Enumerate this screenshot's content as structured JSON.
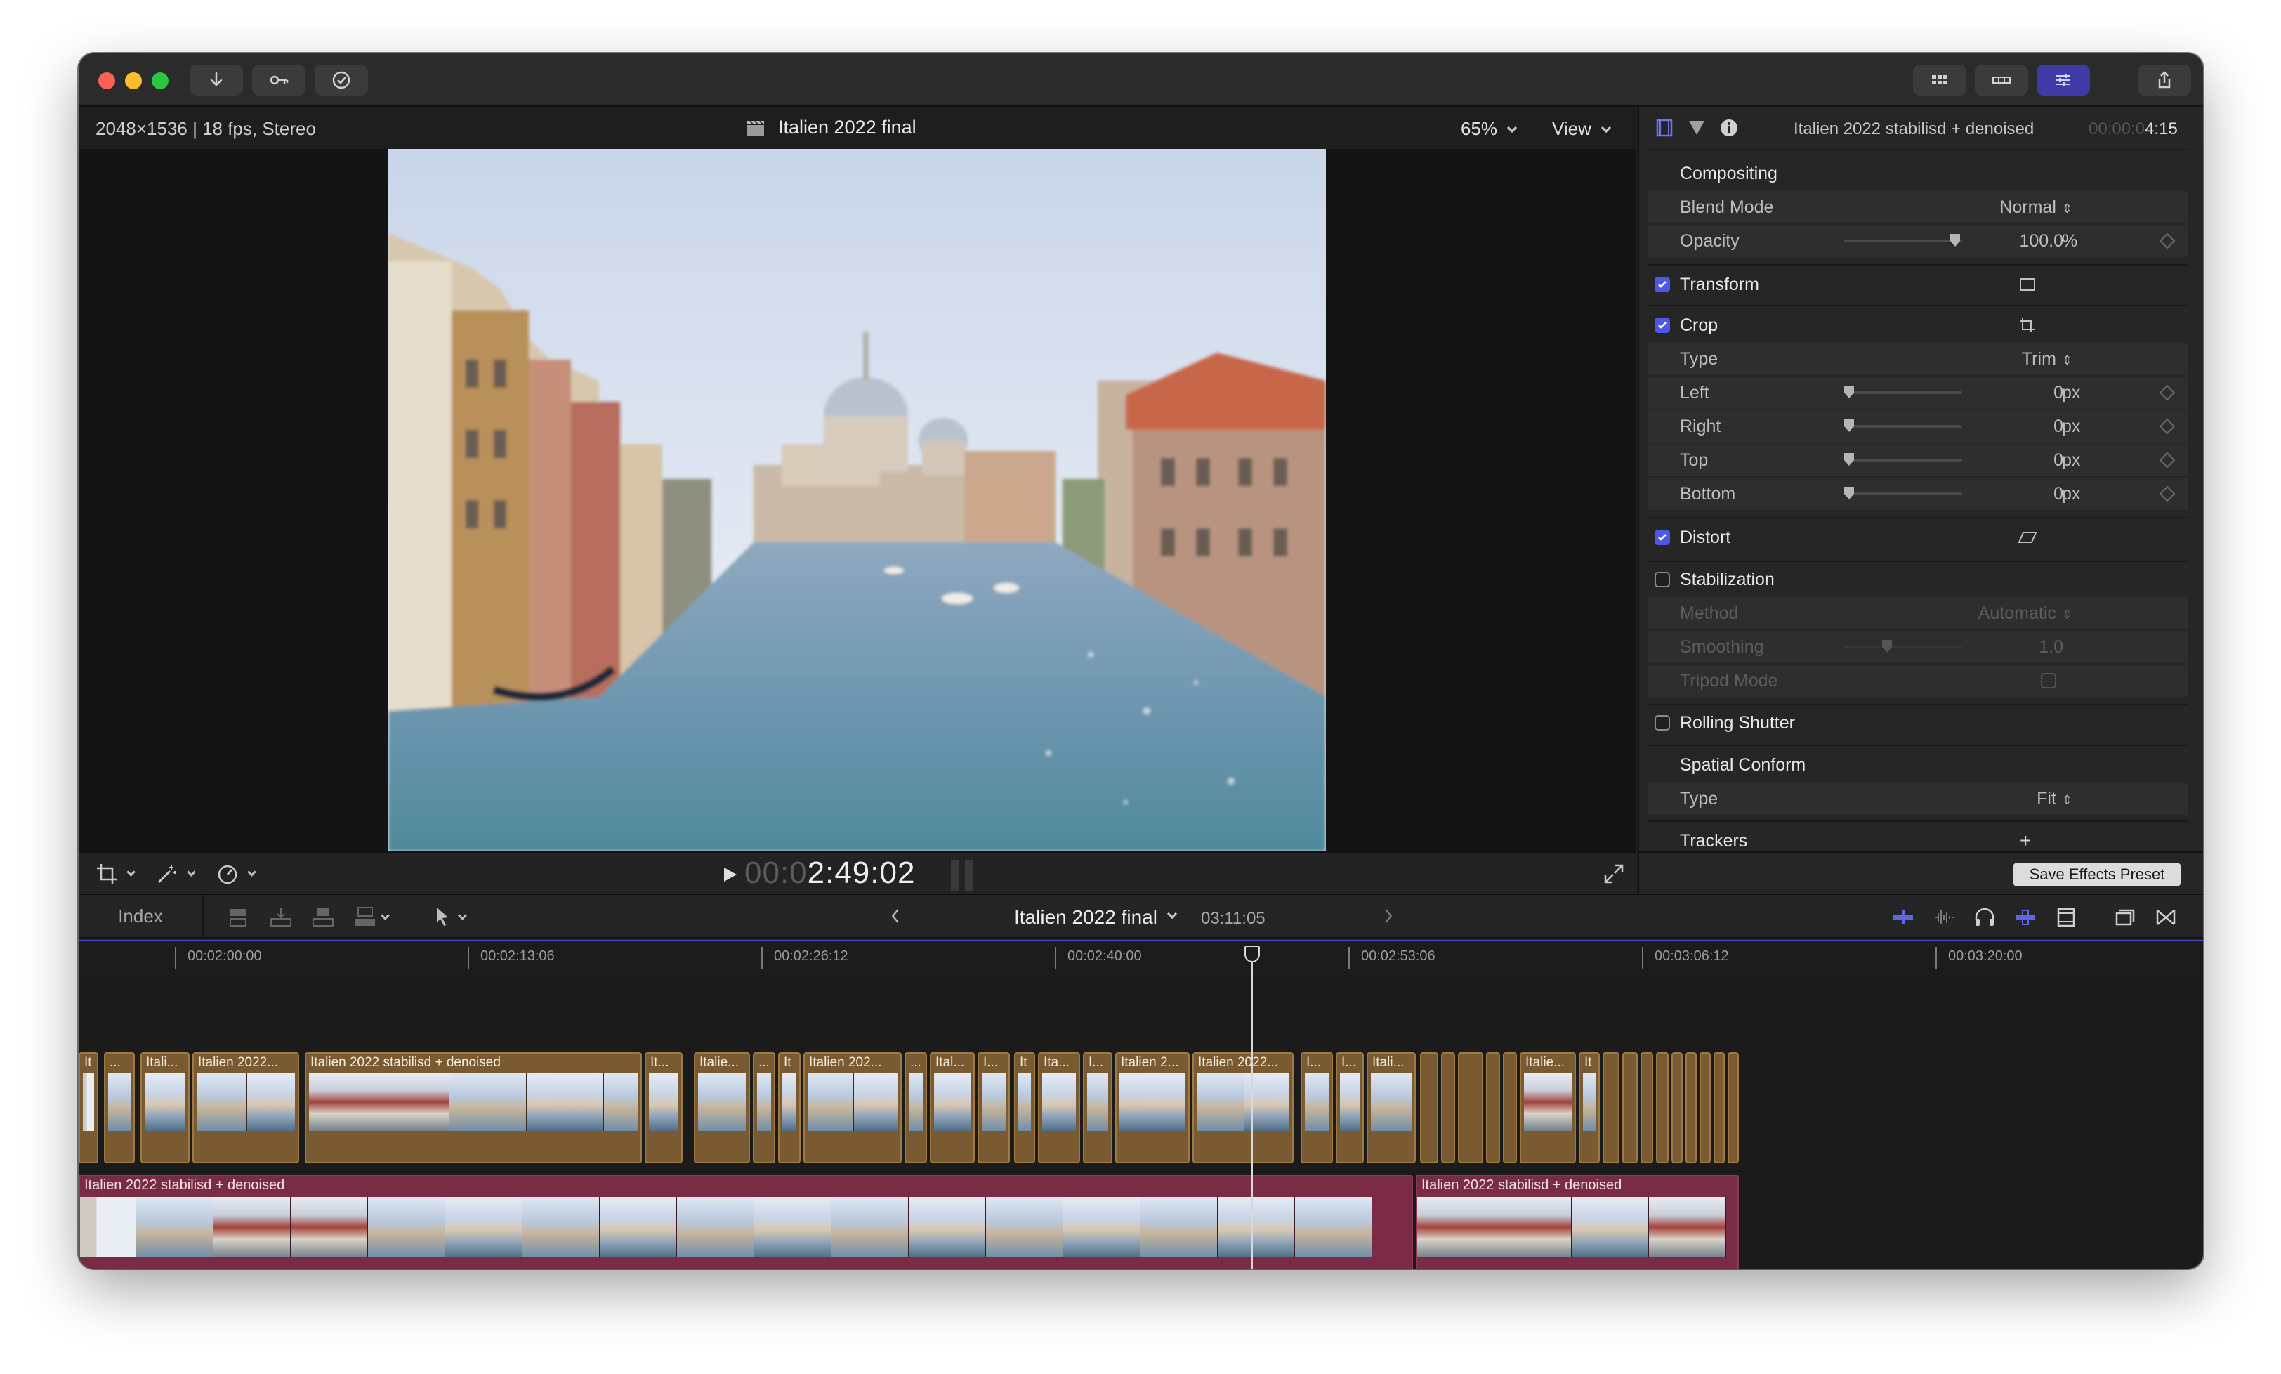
{
  "viewer": {
    "info": "2048×1536 | 18 fps, Stereo",
    "title": "Italien 2022 final",
    "zoom": "65%",
    "view_label": "View",
    "timecode_dim": "00:0",
    "timecode": "2:49:02"
  },
  "inspector": {
    "clip_name": "Italien 2022 stabilisd + denoised",
    "timecode_dim": "00:00:0",
    "timecode": "4:15",
    "compositing": "Compositing",
    "blend_mode_label": "Blend Mode",
    "blend_mode_value": "Normal",
    "opacity_label": "Opacity",
    "opacity_value": "100.0",
    "opacity_unit": "%",
    "opacity_level": 1.0,
    "transform": "Transform",
    "crop": "Crop",
    "crop_type_label": "Type",
    "crop_type_value": "Trim",
    "crop_left_label": "Left",
    "crop_right_label": "Right",
    "crop_top_label": "Top",
    "crop_bottom_label": "Bottom",
    "crop_value": "0",
    "px": "px",
    "distort": "Distort",
    "stabilization": "Stabilization",
    "method_label": "Method",
    "method_value": "Automatic",
    "smoothing_label": "Smoothing",
    "smoothing_value": "1.0",
    "tripod_label": "Tripod Mode",
    "rolling_shutter": "Rolling Shutter",
    "spatial_conform": "Spatial Conform",
    "sc_type_label": "Type",
    "sc_type_value": "Fit",
    "trackers": "Trackers",
    "trackers_add": "+",
    "save_preset": "Save Effects Preset",
    "checked": {
      "transform": true,
      "crop": true,
      "distort": true,
      "stabilization": false,
      "rolling_shutter": false
    }
  },
  "timeline": {
    "index_label": "Index",
    "project_name": "Italien 2022 final",
    "duration": "03:11:05",
    "ruler_labels": [
      "00:02:00:00",
      "00:02:13:06",
      "00:02:26:12",
      "00:02:40:00",
      "00:02:53:06",
      "00:03:06:12",
      "00:03:20:00"
    ],
    "clip_labels": {
      "c1": "It",
      "c2": "...",
      "c3": "Itali...",
      "c4": "Italien 2022...",
      "c5": "Italien 2022 stabilisd + denoised",
      "c6": "It...",
      "c7": "Italie...",
      "c8": "...",
      "c9": "It",
      "c10": "Italien 202...",
      "c11": "...",
      "c12": "Ital...",
      "c13": "I...",
      "c14": "It",
      "c15": "Ita...",
      "c16": "I...",
      "c17": "Italien 2...",
      "c18": "Italien 2022...",
      "c19": "I...",
      "c20": "I...",
      "c21": "Itali...",
      "c22": "Italie...",
      "c23": "It"
    },
    "story_1": "Italien 2022 stabilisd + denoised",
    "story_2": "Italien 2022 stabilisd + denoised"
  },
  "colors": {
    "accent": "#4d59e6",
    "clip": "#7a5a30",
    "storyline": "#7a2b45"
  }
}
